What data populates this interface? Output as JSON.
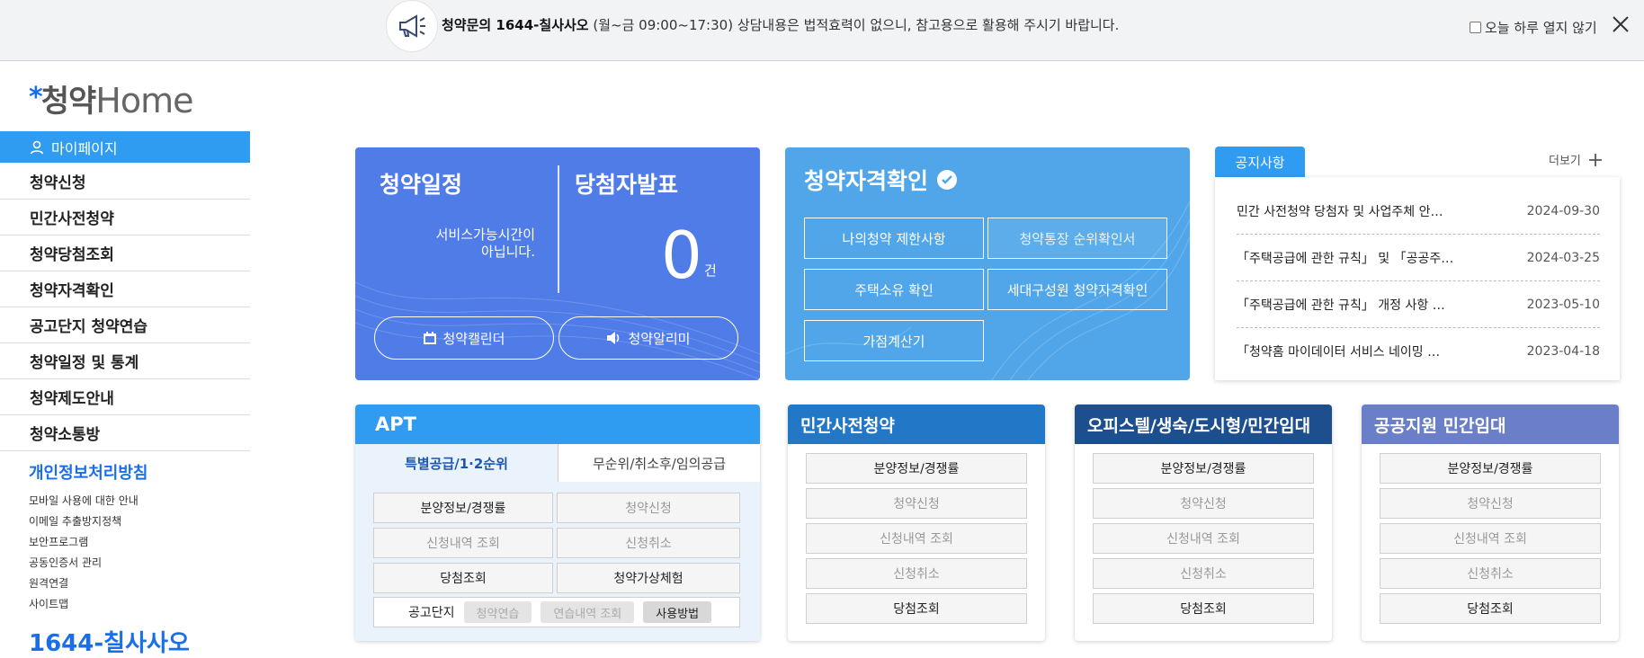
{
  "topbar": {
    "notice_bold": "청약문의 1644-칠사사오",
    "notice_hours": " (월~금 09:00~17:30) ",
    "notice_rest": "상담내용은 법적효력이 없으니, 참고용으로 활용해 주시기 바랍니다.",
    "today_close_label": "오늘 하루 열지 않기"
  },
  "logo": {
    "star": "*",
    "ko": "청약",
    "en": "Home"
  },
  "sidebar": {
    "mypage": "마이페이지",
    "items": [
      "청약신청",
      "민간사전청약",
      "청약당첨조회",
      "청약자격확인",
      "공고단지 청약연습",
      "청약일정 및 통계",
      "청약제도안내",
      "청약소통방"
    ],
    "policy_head": "개인정보처리방침",
    "links": [
      "모바일 사용에 대한 안내",
      "이메일 추출방지정책",
      "보안프로그램",
      "공동인증서 관리",
      "원격연결",
      "사이트맵"
    ],
    "phone": "1644-칠사사오"
  },
  "schedule": {
    "title": "청약일정",
    "winners_title": "당첨자발표",
    "service_msg_line1": "서비스가능시간이",
    "service_msg_line2": "아닙니다.",
    "count": "0",
    "count_unit": "건",
    "calendar_btn": "청약캘린더",
    "alarm_btn": "청약알리미"
  },
  "qualification": {
    "title": "청약자격확인",
    "buttons": [
      "나의청약 제한사항",
      "청약통장 순위확인서",
      "주택소유 확인",
      "세대구성원 청약자격확인",
      "가점계산기"
    ]
  },
  "notices": {
    "tab": "공지사항",
    "more": "더보기",
    "rows": [
      {
        "title": "민간 사전청약 당첨자 및 사업주체 안…",
        "date": "2024-09-30"
      },
      {
        "title": "「주택공급에 관한 규칙」 및 「공공주…",
        "date": "2024-03-25"
      },
      {
        "title": "「주택공급에 관한 규칙」 개정 사항 …",
        "date": "2023-05-10"
      },
      {
        "title": "「청약홈 마이데이터 서비스 네이밍 …",
        "date": "2023-04-18"
      }
    ]
  },
  "apt": {
    "title": "APT",
    "tab_active": "특별공급/1·2순위",
    "tab_other": "무순위/취소후/임의공급",
    "buttons": [
      "분양정보/경쟁률",
      "청약신청",
      "신청내역 조회",
      "신청취소",
      "당첨조회",
      "청약가상체험"
    ],
    "gongo_label": "공고단지",
    "chips": [
      "청약연습",
      "연습내역 조회",
      "사용방법"
    ]
  },
  "private_pre": {
    "title": "민간사전청약",
    "buttons": [
      "분양정보/경쟁률",
      "청약신청",
      "신청내역 조회",
      "신청취소",
      "당첨조회"
    ]
  },
  "officetel": {
    "title": "오피스텔/생숙/도시형/민간임대",
    "buttons": [
      "분양정보/경쟁률",
      "청약신청",
      "신청내역 조회",
      "신청취소",
      "당첨조회"
    ]
  },
  "public_rental": {
    "title": "공공지원 민간임대",
    "buttons": [
      "분양정보/경쟁률",
      "청약신청",
      "신청내역 조회",
      "신청취소",
      "당첨조회"
    ]
  },
  "colors": {
    "accent": "#2f9cf1",
    "schedule_bg": "#4f7ce6",
    "qual_bg": "#50a6e9"
  }
}
